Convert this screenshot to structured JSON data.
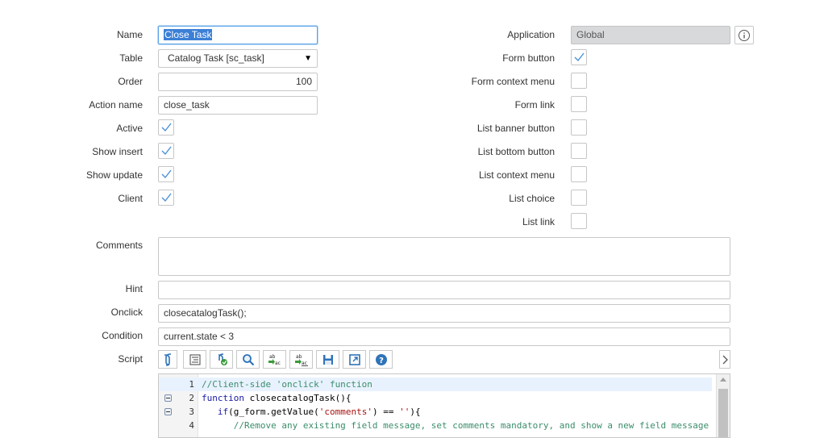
{
  "form": {
    "name": {
      "label": "Name",
      "value": "Close Task"
    },
    "table": {
      "label": "Table",
      "value": "Catalog Task [sc_task]"
    },
    "order": {
      "label": "Order",
      "value": "100"
    },
    "action_name": {
      "label": "Action name",
      "value": "close_task"
    },
    "active": {
      "label": "Active",
      "checked": true
    },
    "show_insert": {
      "label": "Show insert",
      "checked": true
    },
    "show_update": {
      "label": "Show update",
      "checked": true
    },
    "client": {
      "label": "Client",
      "checked": true
    },
    "application": {
      "label": "Application",
      "value": "Global"
    },
    "form_button": {
      "label": "Form button",
      "checked": true
    },
    "form_context_menu": {
      "label": "Form context menu",
      "checked": false
    },
    "form_link": {
      "label": "Form link",
      "checked": false
    },
    "list_banner_button": {
      "label": "List banner button",
      "checked": false
    },
    "list_bottom_button": {
      "label": "List bottom button",
      "checked": false
    },
    "list_context_menu": {
      "label": "List context menu",
      "checked": false
    },
    "list_choice": {
      "label": "List choice",
      "checked": false
    },
    "list_link": {
      "label": "List link",
      "checked": false
    },
    "comments": {
      "label": "Comments",
      "value": ""
    },
    "hint": {
      "label": "Hint",
      "value": ""
    },
    "onclick": {
      "label": "Onclick",
      "value": "closecatalogTask();"
    },
    "condition": {
      "label": "Condition",
      "value": "current.state < 3"
    },
    "script": {
      "label": "Script"
    }
  },
  "toolbar_icons": [
    "script-toggle-icon",
    "format-code-icon",
    "comment-code-icon",
    "search-icon",
    "replace-icon",
    "replace-all-icon",
    "save-icon",
    "fullscreen-icon",
    "help-icon"
  ],
  "script_lines": [
    {
      "n": "1",
      "fold": false,
      "parts": [
        {
          "t": "//Client-side 'onclick' function",
          "c": "com"
        }
      ]
    },
    {
      "n": "2",
      "fold": true,
      "parts": [
        {
          "t": "function",
          "c": "kw"
        },
        {
          "t": " closecatalogTask(){",
          "c": "plain"
        }
      ]
    },
    {
      "n": "3",
      "fold": true,
      "parts": [
        {
          "t": "   ",
          "c": "plain"
        },
        {
          "t": "if",
          "c": "kw"
        },
        {
          "t": "(g_form.getValue(",
          "c": "plain"
        },
        {
          "t": "'comments'",
          "c": "str"
        },
        {
          "t": ") == ",
          "c": "plain"
        },
        {
          "t": "''",
          "c": "str"
        },
        {
          "t": "){",
          "c": "plain"
        }
      ]
    },
    {
      "n": "4",
      "fold": false,
      "parts": [
        {
          "t": "      //Remove any existing field message, set comments mandatory, and show a new field message",
          "c": "com"
        }
      ]
    }
  ],
  "colors": {
    "accent": "#5aa3e8",
    "check": "#4a90d9",
    "readonly": "#d8d9da"
  }
}
